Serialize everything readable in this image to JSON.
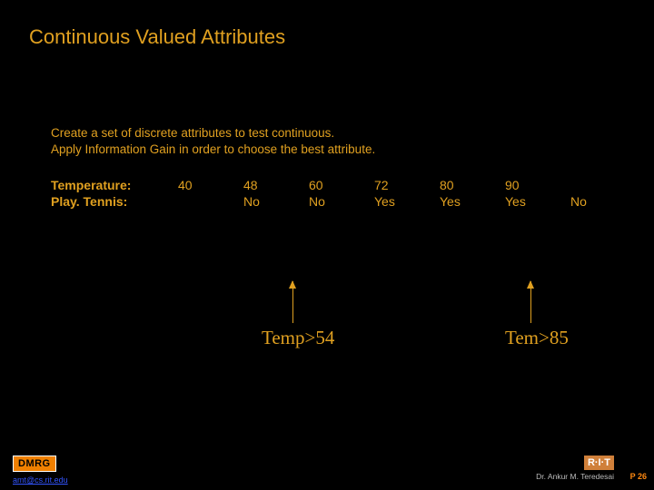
{
  "title": "Continuous Valued Attributes",
  "desc_line1": "Create a set of discrete attributes to test continuous.",
  "desc_line2": "Apply Information Gain in order to choose the best attribute.",
  "rows": {
    "temperature": {
      "label": "Temperature:",
      "values": [
        "40",
        "48",
        "60",
        "72",
        "80",
        "90",
        ""
      ]
    },
    "playtennis": {
      "label": "Play. Tennis:",
      "values": [
        "",
        "No",
        "No",
        "Yes",
        "Yes",
        "Yes",
        "No"
      ]
    }
  },
  "annotations": {
    "a1": "Temp>54",
    "a2": "Tem>85"
  },
  "footer": {
    "dmrg": "DMRG",
    "email": "amt@cs.rit.edu",
    "rit": "R·I·T",
    "author": "Dr. Ankur M. Teredesai",
    "page": "P 26"
  },
  "chart_data": {
    "type": "table",
    "title": "Continuous Valued Attributes",
    "columns": [
      "Temperature",
      "Play.Tennis"
    ],
    "rows": [
      {
        "Temperature": 40,
        "Play.Tennis": null
      },
      {
        "Temperature": 48,
        "Play.Tennis": "No"
      },
      {
        "Temperature": 60,
        "Play.Tennis": "No"
      },
      {
        "Temperature": 72,
        "Play.Tennis": "Yes"
      },
      {
        "Temperature": 80,
        "Play.Tennis": "Yes"
      },
      {
        "Temperature": 90,
        "Play.Tennis": "Yes"
      },
      {
        "Temperature": null,
        "Play.Tennis": "No"
      }
    ],
    "annotations": [
      "Temp>54",
      "Tem>85"
    ]
  }
}
